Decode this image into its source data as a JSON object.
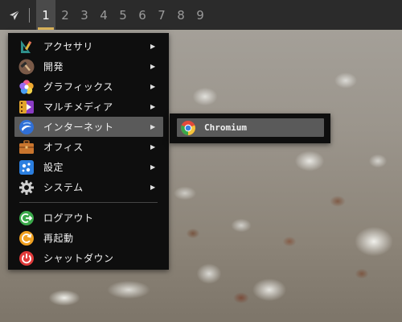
{
  "panel": {
    "launcher_icon": "paper-plane-icon",
    "workspaces": [
      "1",
      "2",
      "3",
      "4",
      "5",
      "6",
      "7",
      "8",
      "9"
    ],
    "active_workspace": "1",
    "accent_color": "#d9b35a"
  },
  "menu": {
    "items": [
      {
        "label": "アクセサリ",
        "icon": "accessories-icon",
        "submenu": true
      },
      {
        "label": "開発",
        "icon": "development-hammer-icon",
        "submenu": true
      },
      {
        "label": "グラフィックス",
        "icon": "graphics-icon",
        "submenu": true
      },
      {
        "label": "マルチメディア",
        "icon": "multimedia-icon",
        "submenu": true
      },
      {
        "label": "インターネット",
        "icon": "internet-globe-icon",
        "submenu": true,
        "highlighted": true
      },
      {
        "label": "オフィス",
        "icon": "office-briefcase-icon",
        "submenu": true
      },
      {
        "label": "設定",
        "icon": "settings-icon",
        "submenu": true
      },
      {
        "label": "システム",
        "icon": "system-gear-icon",
        "submenu": true
      }
    ],
    "session": [
      {
        "label": "ログアウト",
        "icon": "logout-icon"
      },
      {
        "label": "再起動",
        "icon": "restart-icon"
      },
      {
        "label": "シャットダウン",
        "icon": "shutdown-icon"
      }
    ],
    "arrow_glyph": "▶",
    "highlight_color": "#5a5a5a"
  },
  "internet_submenu": {
    "items": [
      {
        "label": "Chromium",
        "icon": "chromium-icon",
        "highlighted": true
      }
    ]
  }
}
